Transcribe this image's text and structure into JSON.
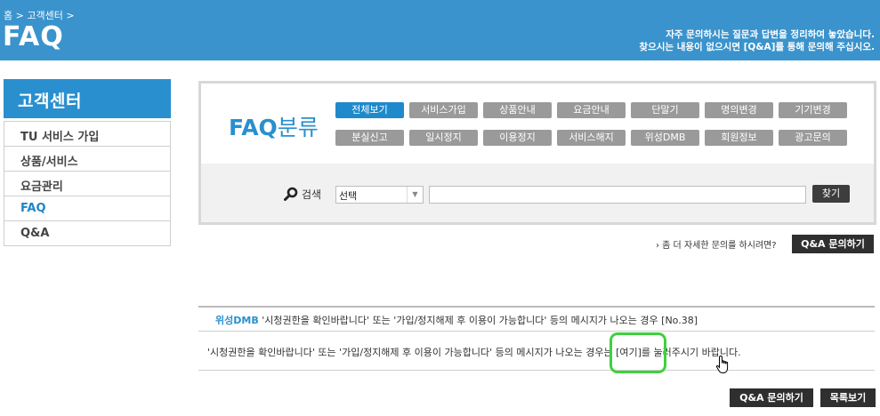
{
  "header": {
    "breadcrumb": [
      "홈",
      "고객센터"
    ],
    "separator": ">",
    "title": "FAQ",
    "desc_line1": "자주 문의하시는 질문과 답변을 정리하여 놓았습니다.",
    "desc_line2": "찾으시는 내용이 없으시면 [Q&A]를 통해 문의해 주십시오."
  },
  "sidebar": {
    "title": "고객센터",
    "items": [
      {
        "label": "TU 서비스 가입"
      },
      {
        "label": "상품/서비스"
      },
      {
        "label": "요금관리"
      },
      {
        "label": "FAQ",
        "active": true
      },
      {
        "label": "Q&A"
      }
    ]
  },
  "category": {
    "label_main": "FAQ",
    "label_sub": "분류",
    "row1": [
      "전체보기",
      "서비스가입",
      "상품안내",
      "요금안내",
      "단말기",
      "명의변경",
      "기기변경"
    ],
    "row2": [
      "분실신고",
      "일시정지",
      "이용정지",
      "서비스해지",
      "위성DMB",
      "회원정보",
      "광고문의"
    ],
    "active": "전체보기"
  },
  "search": {
    "label": "검색",
    "select_value": "선택",
    "input_value": "",
    "button": "찾기"
  },
  "inquiry": {
    "text": "› 좀 더 자세한 문의를 하시려면?",
    "button": "Q&A 문의하기"
  },
  "faq": {
    "category": "위성DMB",
    "question": "'시청권한을 확인바랍니다' 또는 '가입/정지해제 후 이용이 가능합니다' 등의 메시지가 나오는 경우",
    "number": "[No.38]",
    "answer_before": "'시청권한을 확인바랍니다' 또는 '가입/정지해제 후 이용이 가능합니다' 등의 메시지가 나오는 경우는",
    "answer_link": "[여기]",
    "answer_after": "를 눌러주시기 바랍니다."
  },
  "bottom": {
    "qa_button": "Q&A 문의하기",
    "list_button": "목록보기"
  },
  "colors": {
    "header_bg": "#3a93cc",
    "accent": "#2a8fce",
    "button_dark": "#2f2f2f",
    "button_gray": "#9a9a9a",
    "highlight_ring": "#3fd13f"
  },
  "icons": {
    "search": "magnifier-icon",
    "cursor": "hand-pointer-icon"
  }
}
